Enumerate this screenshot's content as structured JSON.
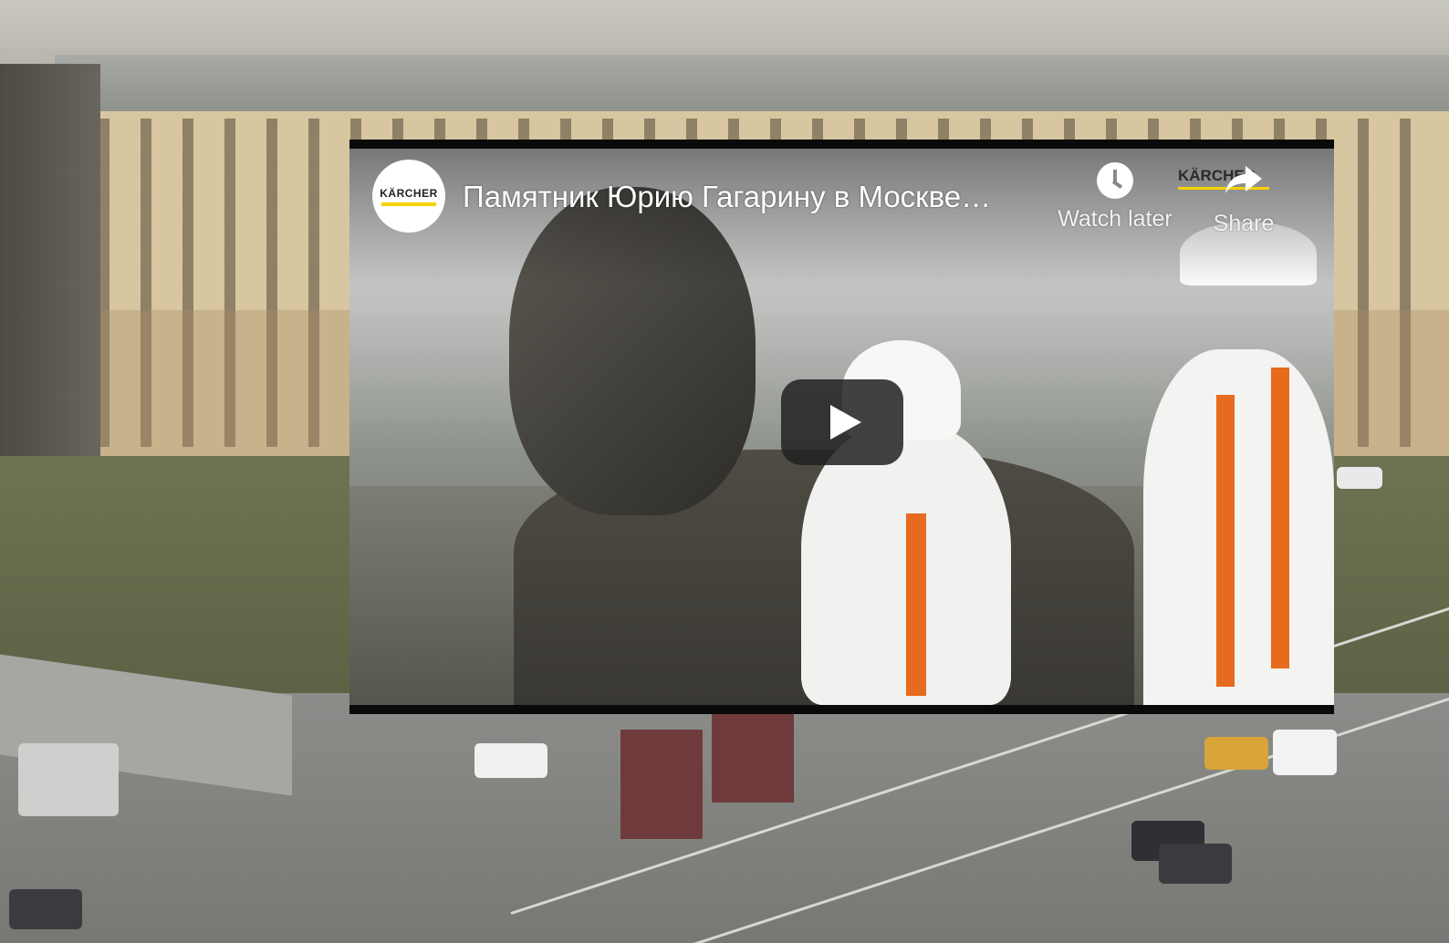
{
  "video": {
    "title": "Памятник Юрию Гагарину в Москве…",
    "channel_logo_text": "KÄRCHER",
    "brand_watermark": "KÄRCHER",
    "actions": {
      "watch_later_label": "Watch later",
      "share_label": "Share"
    },
    "icons": {
      "watch_later": "clock-icon",
      "share": "share-arrow-icon",
      "play": "play-icon"
    },
    "colors": {
      "brand_yellow": "#f5d200",
      "play_button_bg": "#212121",
      "title_text": "#ffffff"
    }
  }
}
